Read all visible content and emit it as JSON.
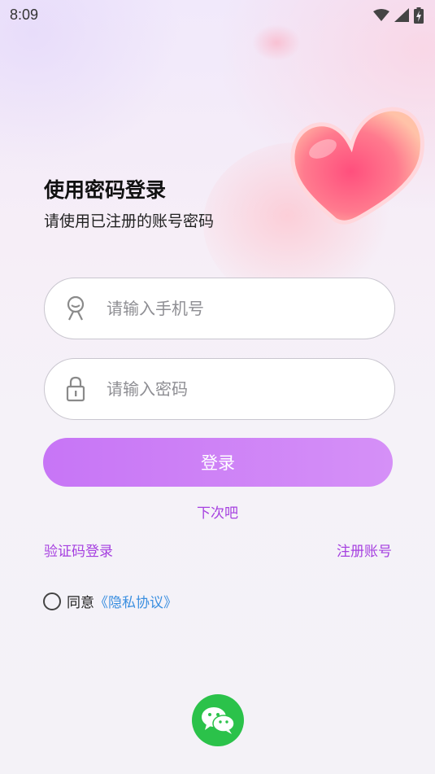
{
  "status_bar": {
    "time": "8:09",
    "icons": [
      "wifi-icon",
      "signal-icon",
      "battery-charging-icon"
    ]
  },
  "header": {
    "title": "使用密码登录",
    "subtitle": "请使用已注册的账号密码"
  },
  "form": {
    "phone_placeholder": "请输入手机号",
    "password_placeholder": "请输入密码",
    "phone_icon": "user-icon",
    "password_icon": "lock-icon"
  },
  "actions": {
    "login_label": "登录",
    "skip_label": "下次吧",
    "sms_login_label": "验证码登录",
    "register_label": "注册账号"
  },
  "agreement": {
    "prefix": "同意",
    "link": "《隐私协议》",
    "checked": false
  },
  "social": {
    "wechat_icon": "wechat-icon"
  },
  "colors": {
    "accent": "#a640e0",
    "button_start": "#c775f6",
    "button_end": "#d590f7",
    "link_blue": "#3a8fe0",
    "wechat_green": "#2bc24a"
  }
}
